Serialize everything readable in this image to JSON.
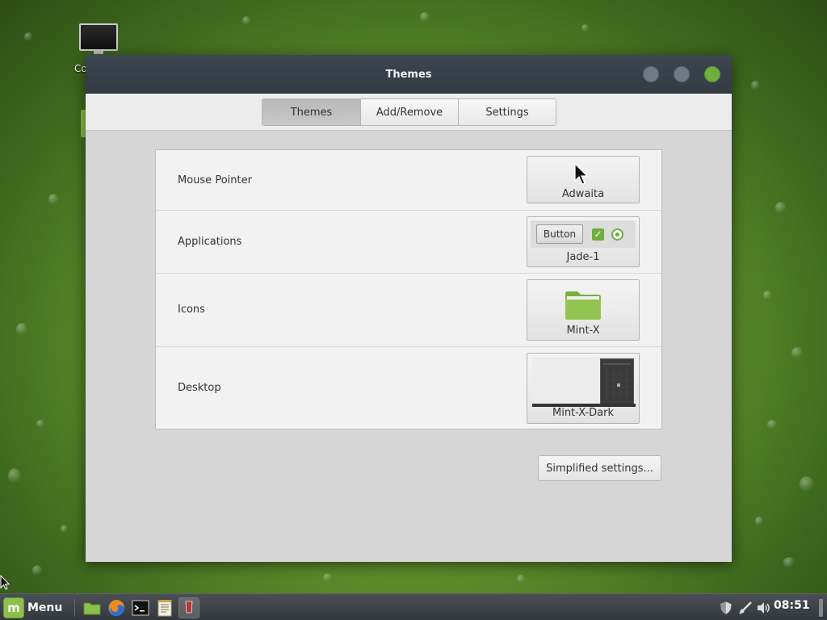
{
  "desktop": {
    "icon_label": "Co"
  },
  "window": {
    "title": "Themes"
  },
  "tabs": [
    {
      "label": "Themes",
      "active": true
    },
    {
      "label": "Add/Remove",
      "active": false
    },
    {
      "label": "Settings",
      "active": false
    }
  ],
  "rows": {
    "mouse_pointer": {
      "label": "Mouse Pointer",
      "value": "Adwaita"
    },
    "applications": {
      "label": "Applications",
      "value": "Jade-1",
      "preview_button": "Button"
    },
    "icons": {
      "label": "Icons",
      "value": "Mint-X"
    },
    "desktop": {
      "label": "Desktop",
      "value": "Mint-X-Dark"
    }
  },
  "simplified_button": "Simplified settings...",
  "taskbar": {
    "menu_label": "Menu",
    "clock": "08:51",
    "launchers": [
      "files-icon",
      "firefox-icon",
      "terminal-icon",
      "text-editor-icon",
      "themes-app-icon"
    ],
    "tray": [
      "shield-icon",
      "network-icon",
      "volume-icon"
    ]
  },
  "colors": {
    "accent": "#6fae3f",
    "titlebar": "#3d4650",
    "window_bg": "#d6d6d6"
  }
}
